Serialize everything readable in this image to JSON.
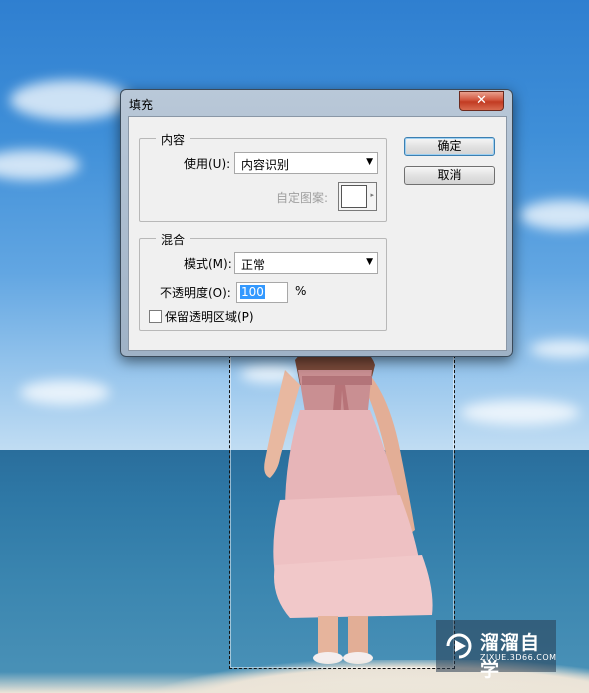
{
  "dialog": {
    "title": "填充",
    "close_glyph": "✕",
    "content_group": {
      "legend": "内容",
      "use_label": "使用(U):",
      "use_value": "内容识别",
      "custom_pattern_label": "自定图案:"
    },
    "blend_group": {
      "legend": "混合",
      "mode_label": "模式(M):",
      "mode_value": "正常",
      "opacity_label": "不透明度(O):",
      "opacity_value": "100",
      "opacity_unit": "%",
      "preserve_transparency_label": "保留透明区域(P)",
      "preserve_transparency_checked": false
    },
    "ok_label": "确定",
    "cancel_label": "取消"
  },
  "watermark": {
    "title": "溜溜自学",
    "url": "ZIXUE.3D66.COM"
  }
}
